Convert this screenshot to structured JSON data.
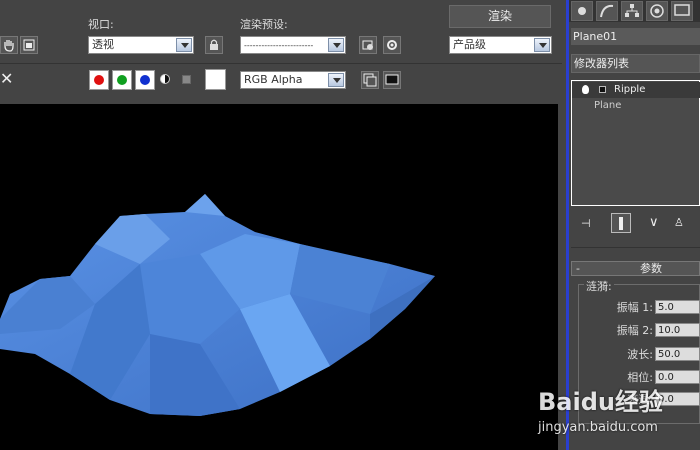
{
  "toolbar": {
    "viewport_label": "视口:",
    "viewport_value": "透视",
    "render_preset_label": "渲染预设:",
    "render_preset_value": "------------------------",
    "render_button": "渲染",
    "quality_value": "产品级",
    "channel_value": "RGB Alpha",
    "close_symbol": "✕",
    "colors": {
      "red": "#e01010",
      "green": "#10a020",
      "blue": "#1030d0"
    }
  },
  "panel": {
    "object_name": "Plane01",
    "modifier_list": "修改器列表",
    "stack": [
      {
        "label": "Ripple",
        "active": true
      },
      {
        "label": "Plane",
        "active": false
      }
    ],
    "rollout_title": "参数",
    "rollout_toggle": "-",
    "group_title": "涟漪:",
    "params": [
      {
        "label": "振幅 1:",
        "value": "5.0"
      },
      {
        "label": "振幅 2:",
        "value": "10.0"
      },
      {
        "label": "波长:",
        "value": "50.0"
      },
      {
        "label": "相位:",
        "value": "0.0"
      },
      {
        "label": "衰退:",
        "value": "0.0"
      }
    ]
  },
  "viewport": {
    "background": "#000000",
    "mesh_color": "#4f86d8"
  },
  "watermark": {
    "brand": "Baidu经验",
    "url": "jingyan.baidu.com"
  }
}
